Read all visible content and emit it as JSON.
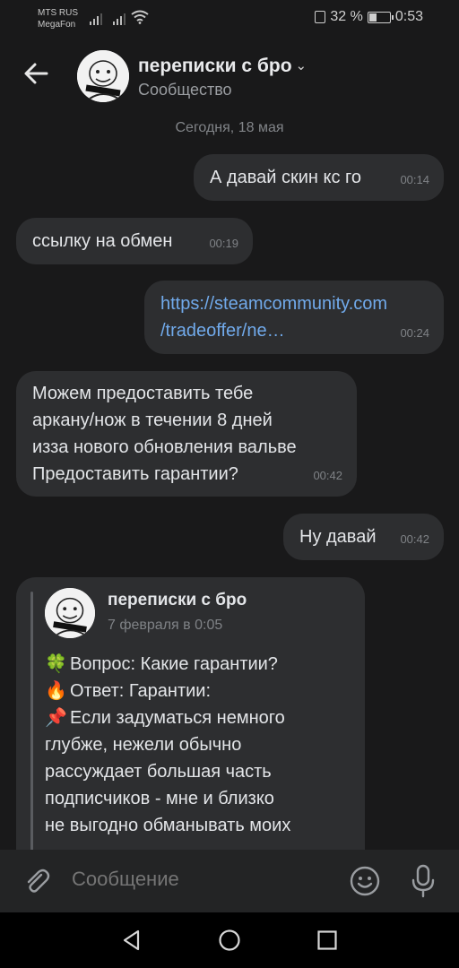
{
  "status": {
    "carrier1": "MTS RUS",
    "carrier2": "MegaFon",
    "battery": "32 %",
    "battery_level": 0.32,
    "time": "0:53"
  },
  "header": {
    "title": "переписки с бро",
    "subtitle": "Сообщество",
    "avatar_icon": "meme-face-avatar",
    "back_icon": "arrow-left-icon"
  },
  "chat": {
    "date_separator": "Сегодня, 18 мая",
    "messages": [
      {
        "text": "А давай скин кс го",
        "time": "00:14",
        "side": "out"
      },
      {
        "text": "ссылку на обмен",
        "time": "00:19",
        "side": "in"
      },
      {
        "text": "https://steamcommunity.com\n/tradeoffer/ne…",
        "time": "00:24",
        "side": "out",
        "is_link": true
      },
      {
        "text": "Можем предоставить тебе\nаркану/нож в течении 8 дней\nизза нового обновления вальве\nПредоставить гарантии?",
        "time": "00:42",
        "side": "in"
      },
      {
        "text": "Ну давай",
        "time": "00:42",
        "side": "out"
      }
    ],
    "forwarded": {
      "author": "переписки с бро",
      "date": "7 февраля в 0:05",
      "line1_emoji": "🍀",
      "line1": "Вопрос: Какие гарантии?",
      "line2_emoji": "🔥",
      "line2": "Ответ: Гарантии:",
      "line3_emoji": "📌",
      "line3": "Если задуматься немного\nглубже, нежели обычно\nрассуждает большая часть\nподписчиков - мне и близко\nне выгодно обманывать моих"
    }
  },
  "composer": {
    "placeholder": "Сообщение",
    "attach_icon": "paperclip-icon",
    "emoji_icon": "smiley-icon",
    "mic_icon": "microphone-icon"
  },
  "colors": {
    "background": "#19191a",
    "bubble": "#2d2e30",
    "link": "#71aaeb",
    "muted": "#7f8286"
  }
}
